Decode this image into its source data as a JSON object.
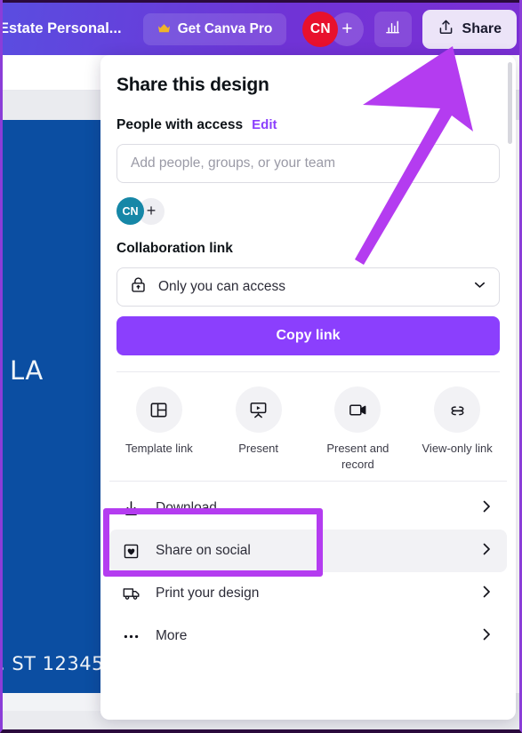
{
  "topbar": {
    "doc_title": "Estate Personal...",
    "pro_button": {
      "label": "Get Canva Pro",
      "icon": "crown-icon"
    },
    "avatar": {
      "initials": "CN",
      "color": "#e8112d"
    },
    "add_collaborator": "+",
    "analytics_icon": "bar-chart-icon",
    "share_button": {
      "label": "Share",
      "icon": "share-upload-icon"
    }
  },
  "canvas": {
    "line1": "LA",
    "line2": ", ST 12345"
  },
  "dialog": {
    "title": "Share this design",
    "people_section": {
      "label": "People with access",
      "edit_link": "Edit",
      "input_placeholder": "Add people, groups, or your team",
      "collaborators": [
        {
          "initials": "CN",
          "color": "#1687a7"
        }
      ],
      "add_label": "+"
    },
    "collab_section": {
      "label": "Collaboration link",
      "access_value": "Only you can access",
      "access_icon": "lock-icon",
      "chevron_icon": "chevron-down-icon",
      "copy_button": "Copy link"
    },
    "quick_actions": [
      {
        "label": "Template link",
        "icon": "template-link-icon"
      },
      {
        "label": "Present",
        "icon": "present-icon"
      },
      {
        "label": "Present and record",
        "icon": "present-record-icon"
      },
      {
        "label": "View-only link",
        "icon": "view-only-link-icon"
      }
    ],
    "menu_items": [
      {
        "label": "Download",
        "icon": "download-icon",
        "hovered": false,
        "highlighted": true
      },
      {
        "label": "Share on social",
        "icon": "share-social-icon",
        "hovered": true,
        "highlighted": false
      },
      {
        "label": "Print your design",
        "icon": "print-truck-icon",
        "hovered": false,
        "highlighted": false
      },
      {
        "label": "More",
        "icon": "more-dots-icon",
        "hovered": false,
        "highlighted": false
      }
    ]
  },
  "annotations": {
    "arrow_color": "#b43cf0",
    "box_color": "#b43cf0"
  }
}
